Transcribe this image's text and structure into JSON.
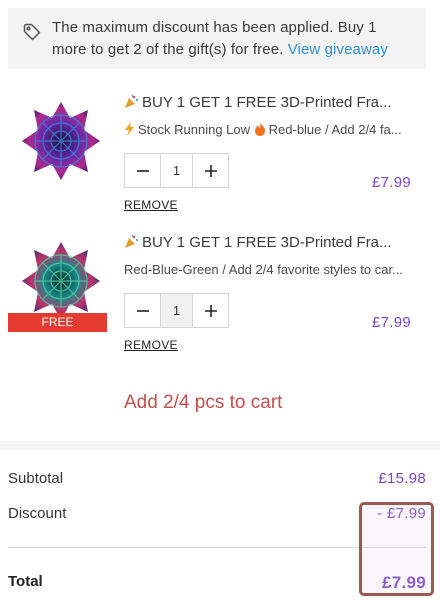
{
  "notice": {
    "message": "The maximum discount has been applied. Buy 1 more to get 2 of the gift(s) for free.",
    "link_label": "View giveaway"
  },
  "items": [
    {
      "title": "BUY 1 GET 1 FREE 3D-Printed Fra...",
      "variant_prefix": "Stock Running Low",
      "variant": "Red-blue / Add 2/4 fa...",
      "quantity": "1",
      "remove_label": "REMOVE",
      "price": "£7.99",
      "free": false
    },
    {
      "title": "BUY 1 GET 1 FREE 3D-Printed Fra...",
      "variant": "Red-Blue-Green / Add 2/4 favorite styles to car...",
      "quantity": "1",
      "remove_label": "REMOVE",
      "price": "£7.99",
      "free": true,
      "free_badge": "FREE"
    }
  ],
  "add_more_label": "Add 2/4 pcs to cart",
  "summary": {
    "subtotal_label": "Subtotal",
    "subtotal_value": "£15.98",
    "discount_label": "Discount",
    "discount_value": "- £7.99",
    "total_label": "Total",
    "total_value": "£7.99"
  },
  "icons": {
    "notice": "price-tag-icon",
    "party": "party-popper-icon",
    "spiral": "cyclone-icon",
    "lightning": "lightning-icon",
    "fire": "fire-icon",
    "minus": "minus-icon",
    "plus": "plus-icon"
  },
  "colors": {
    "price": "#7a46c4",
    "link": "#2e8fd6",
    "add_more": "#c0504d",
    "free_badge": "#e43a2f",
    "highlight_border": "#9a5a52"
  }
}
